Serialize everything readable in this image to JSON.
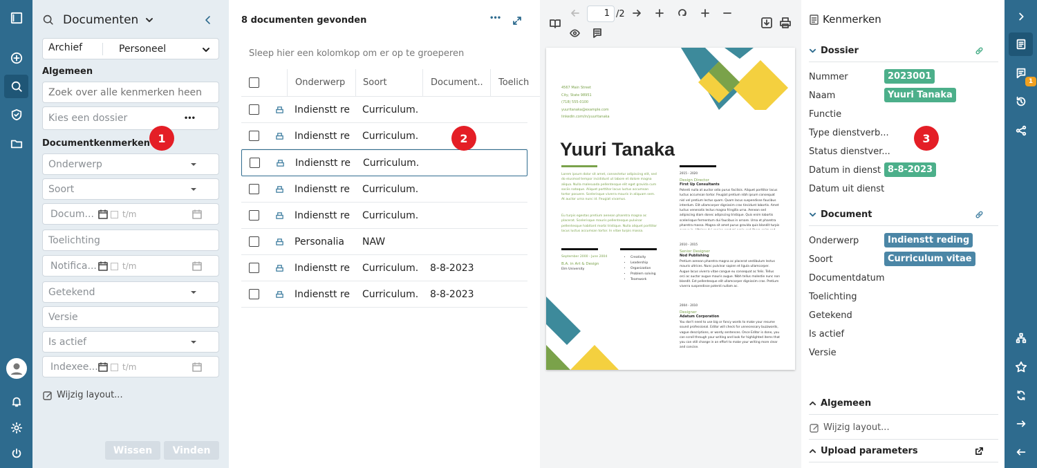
{
  "search_panel": {
    "title": "Documenten",
    "archive_label": "Archief",
    "archive_value": "Personeel",
    "general_heading": "Algemeen",
    "search_placeholder": "Zoek over alle kenmerken heen",
    "dossier_placeholder": "Kies een dossier",
    "dossier_more": "•••",
    "doc_props_heading": "Documentkenmerken",
    "fields": {
      "onderwerp": "Onderwerp",
      "soort": "Soort",
      "documentdatum": "Docum...",
      "range_to": "t/m",
      "toelichting": "Toelichting",
      "notificatie": "Notifica...",
      "getekend": "Getekend",
      "versie": "Versie",
      "is_actief": "Is actief",
      "indexeer": "Indexee..."
    },
    "edit_layout": "Wijzig layout...",
    "clear_button": "Wissen",
    "find_button": "Vinden"
  },
  "doc_list": {
    "count_text": "8 documenten gevonden",
    "more": "•••",
    "group_hint": "Sleep hier een kolomkop om er op te groeperen",
    "columns": [
      "Onderwerp",
      "Soort",
      "Document...",
      "Toelich"
    ],
    "rows": [
      {
        "onderwerp": "Indienstt re...",
        "soort": "Curriculum...",
        "datum": ""
      },
      {
        "onderwerp": "Indienstt re...",
        "soort": "Curriculum...",
        "datum": ""
      },
      {
        "onderwerp": "Indienstt re...",
        "soort": "Curriculum...",
        "datum": ""
      },
      {
        "onderwerp": "Indienstt re...",
        "soort": "Curriculum...",
        "datum": ""
      },
      {
        "onderwerp": "Indienstt re...",
        "soort": "Curriculum...",
        "datum": ""
      },
      {
        "onderwerp": "Personalia",
        "soort": "NAW",
        "datum": ""
      },
      {
        "onderwerp": "Indienstt re...",
        "soort": "Curriculum...",
        "datum": "8-8-2023"
      },
      {
        "onderwerp": "Indienstt re...",
        "soort": "Curriculum...",
        "datum": "8-8-2023"
      }
    ]
  },
  "viewer": {
    "page_current": "1",
    "page_total": "/2",
    "resume": {
      "contact": [
        "4567 Main Street",
        "City, State 98951",
        "(718) 555-0100",
        "yuuritanaka@example.com",
        "linkedin.com/in/yuuritanaka"
      ],
      "name": "Yuuri Tanaka",
      "intro": "Lorem ipsum dolor sit amet, consectetur adipiscing elit, sed do eiusmod tempor incididunt ut labore et dolore magna aliqua. Nulla malesuada pellentesque elit eget gravida cum sociis natoque. Aliquet porttitor lacus luctus accumsan tortor posuere. Scelerisque viverra mauris in aliquam sem. At auctor urna nunc id. Feugiat vivamus.",
      "intro2": "Eu turpis egestas pretium aenean pharetra magna ac placerat. Scelerisque mauris pellentesque pulvinar pellentesque habitant morbi tristique. Nulla aliquet porttitor lacus luctus accumsan tortor. In vitae turpis massa.",
      "edu_date": "September 2000 - June 2004",
      "edu_degree": "B.A. in Art & Design",
      "edu_school": "Elm University",
      "skills": [
        "Creativity",
        "Leadership",
        "Organization",
        "Problem solving",
        "Teamwork"
      ],
      "jobs": [
        {
          "dates": "2015 - 2020",
          "title": "Design Director",
          "company": "First Up Consultants",
          "text": "Potenti nulla at auctor odio purus facilisis. Aliquet porttitor lacus luctus accumsan tortor. Feugiat pretium nibh ipsum consequat nisl vel pretium lectus quam. Quam lacus suspendisse faucibus interdum. Elit ullamcorper dignissim cras tincidunt lobortis. Amet luctus venenatis lectus magna fringilla urna. Aenean sed adipiscing diam donec adipiscing tristique. Quis enim lobortis scelerisque fermentum dui faucibus in ornare. Urna et pharetra pharetra massa. Magna sit amet purus gravida quis blandit turpis cursus in. Ultrices dui sapien eget mi proin sed libero enim sed. Nunc sed id semper risus in hendrerit gravida rutrum quisque. Est ante in nibh mauris cursus mattis molestie. Quis enim lobortis scelerisque fermentum dui faucibus in ornare quam."
        },
        {
          "dates": "2010 - 2015",
          "title": "Senior Designer",
          "company": "Nod Publishing",
          "text": "Pretium aenean pharetra magna ac placerat vestibulum lectus mauris ultrices. Nunc pulvinar sapien et ligula ullamcorper. Augue lacus viverra vitae congue eu consequat ac felis. Tellus orci ac auctor augue mauris augue. Nibh tellus molestie nunc non blandit. Est pellentesque elit ullamcorper dignissim cras. Pretium viverra suspendisse potenti nullam ac."
        },
        {
          "dates": "2004 - 2010",
          "title": "Designer",
          "company": "Adatum Corporation",
          "text": "You don't need to use big or fancy words to make your resume sound professional. Editor will check for unnecessary buzzwords, vague descriptions, or wordy sentences. Once Editor is done, you can scroll through your writing and look for highlighted items that you can still change in an effort to make your writing more clear and concise."
        }
      ]
    }
  },
  "properties": {
    "title": "Kenmerken",
    "dossier_heading": "Dossier",
    "dossier_rows": [
      {
        "label": "Nummer",
        "value": "2023001"
      },
      {
        "label": "Naam",
        "value": "Yuuri Tanaka"
      },
      {
        "label": "Functie",
        "value": ""
      },
      {
        "label": "Type dienstverb...",
        "value": ""
      },
      {
        "label": "Status dienstver...",
        "value": ""
      },
      {
        "label": "Datum in dienst",
        "value": "8-8-2023"
      },
      {
        "label": "Datum uit dienst",
        "value": ""
      }
    ],
    "document_heading": "Document",
    "document_rows": [
      {
        "label": "Onderwerp",
        "value": "Indienstt reding"
      },
      {
        "label": "Soort",
        "value": "Curriculum vitae"
      },
      {
        "label": "Documentdatum",
        "value": ""
      },
      {
        "label": "Toelichting",
        "value": ""
      },
      {
        "label": "Getekend",
        "value": ""
      },
      {
        "label": "Is actief",
        "value": ""
      },
      {
        "label": "Versie",
        "value": ""
      }
    ],
    "general_heading": "Algemeen",
    "edit_layout": "Wijzig layout...",
    "upload_heading": "Upload parameters"
  },
  "rail_badge": "1",
  "annotations": [
    "1",
    "2",
    "3"
  ],
  "colors": {
    "rail": "#2e6b8e",
    "green_chip": "#4caf8a",
    "blue_chip": "#4b86a6",
    "accent": "#2e6b8e",
    "badge": "#e41e26"
  }
}
